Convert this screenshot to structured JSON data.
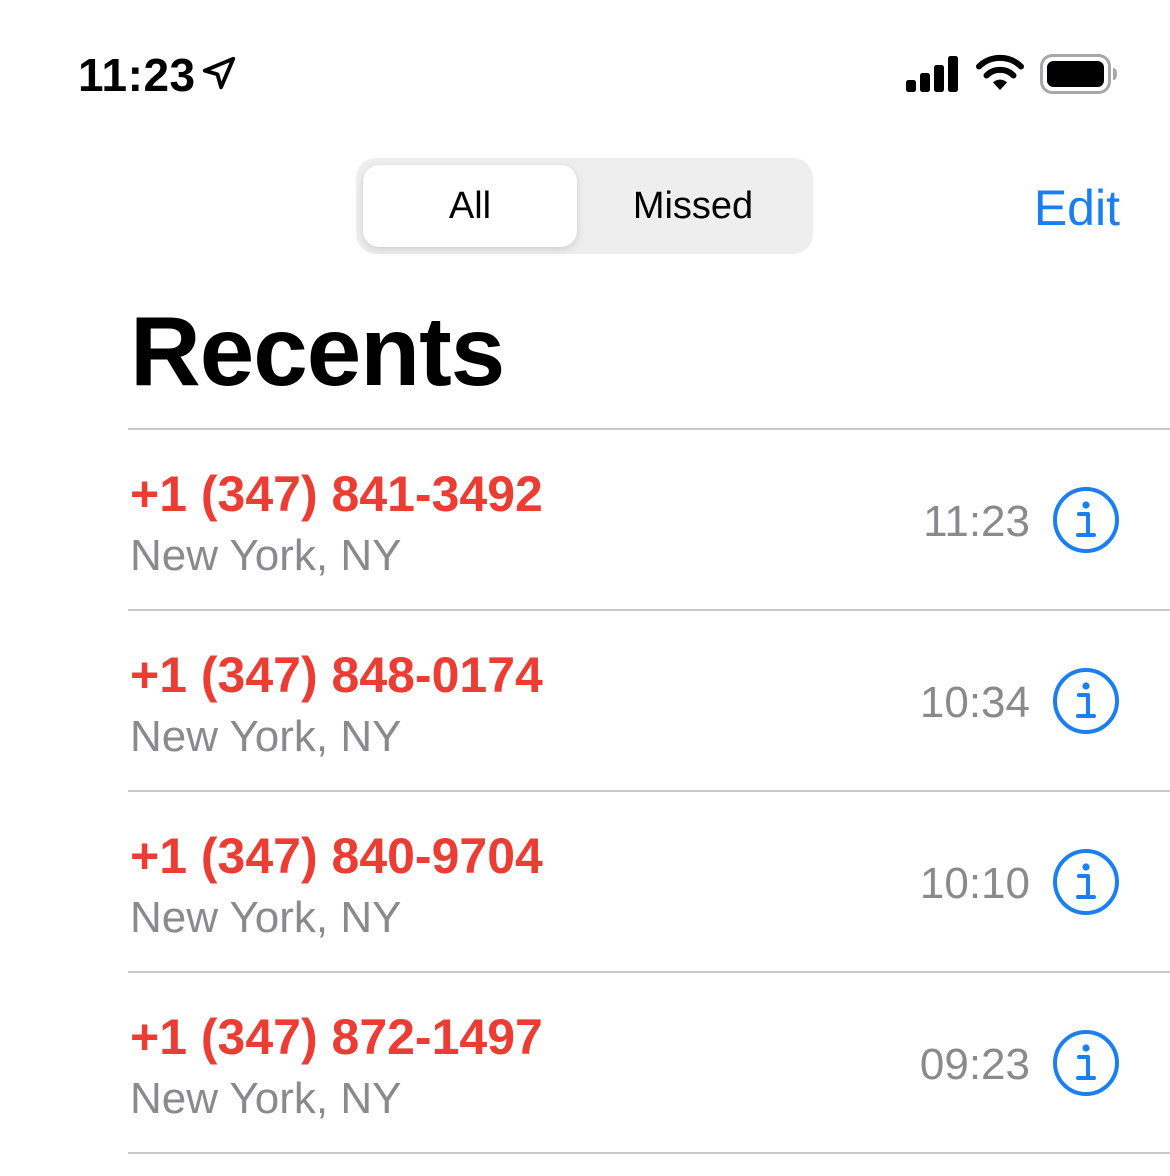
{
  "status_bar": {
    "time": "11:23",
    "icons": [
      "location-arrow-icon",
      "cellular-signal-icon",
      "wifi-icon",
      "battery-icon"
    ]
  },
  "header": {
    "segments": [
      "All",
      "Missed"
    ],
    "selected_segment": "All",
    "edit_label": "Edit"
  },
  "page": {
    "title": "Recents"
  },
  "calls": [
    {
      "number": "+1 (347) 841-3492",
      "location": "New York, NY",
      "time": "11:23"
    },
    {
      "number": "+1 (347) 848-0174",
      "location": "New York, NY",
      "time": "10:34"
    },
    {
      "number": "+1 (347) 840-9704",
      "location": "New York, NY",
      "time": "10:10"
    },
    {
      "number": "+1 (347) 872-1497",
      "location": "New York, NY",
      "time": "09:23"
    }
  ],
  "colors": {
    "missed_call": "#eb3d34",
    "accent": "#1a7ff0",
    "secondary_text": "#8a8a8e",
    "separator": "#c8c8cc",
    "segment_background": "#eeeeef"
  }
}
